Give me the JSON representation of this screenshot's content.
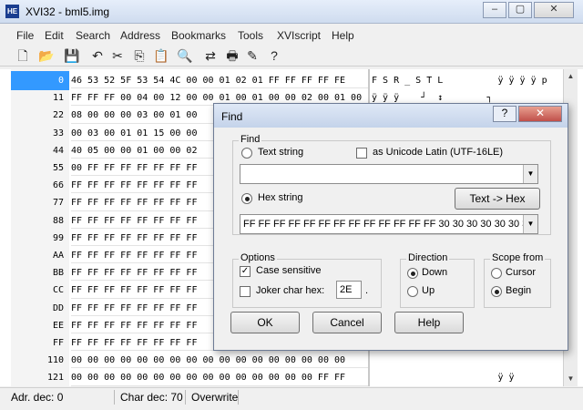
{
  "window": {
    "title": "XVI32 - bml5.img",
    "icon_label": "HE",
    "minimize": "–",
    "maximize": "▢",
    "close": "✕"
  },
  "menu": [
    "File",
    "Edit",
    "Search",
    "Address",
    "Bookmarks",
    "Tools",
    "XVIscript",
    "Help"
  ],
  "toolbar_icons": [
    "new-file-icon",
    "open-folder-icon",
    "save-icon",
    "cut-icon",
    "copy-icon",
    "paste-icon",
    "find-icon",
    "replace-icon",
    "print-icon",
    "edit-icon",
    "help-icon"
  ],
  "addresses": [
    "0",
    "11",
    "22",
    "33",
    "44",
    "55",
    "66",
    "77",
    "88",
    "99",
    "AA",
    "BB",
    "CC",
    "DD",
    "EE",
    "FF",
    "110",
    "121"
  ],
  "hex_rows": [
    "46 53 52 5F 53 54 4C 00 00 01 02 01 FF FF FF FF FE",
    "FF FF FF 00 04 00 12 00 00 01 00 01 00 00 02 00 01 00",
    "08 00 00 00 03 00 01 00",
    "00 03 00 01 01 15 00 00",
    "40 05 00 00 01 00 00 02",
    "00 FF FF FF FF FF FF FF",
    "FF FF FF FF FF FF FF FF",
    "FF FF FF FF FF FF FF FF",
    "FF FF FF FF FF FF FF FF",
    "FF FF FF FF FF FF FF FF",
    "FF FF FF FF FF FF FF FF",
    "FF FF FF FF FF FF FF FF",
    "FF FF FF FF FF FF FF FF",
    "FF FF FF FF FF FF FF FF",
    "FF FF FF FF FF FF FF FF",
    "FF FF FF FF FF FF FF FF",
    "00 00 00 00 00 00 00 00 00 00 00 00 00 00 00 00 00",
    "00 00 00 00 00 00 00 00 00 00 00 00 00 00 00 FF FF"
  ],
  "ascii_rows": [
    "F S R _ S T L          ÿ ÿ ÿ ÿ p",
    "ÿ ÿ ÿ    ┘  ↕        ┐",
    "",
    "",
    "",
    "",
    "",
    "",
    "",
    "",
    "",
    "",
    "",
    "",
    "",
    "",
    "",
    "                       ÿ ÿ"
  ],
  "status": {
    "addr": "Adr. dec: 0",
    "char": "Char dec: 70",
    "mode": "Overwrite"
  },
  "dialog": {
    "title": "Find",
    "help_btn": "?",
    "close_btn": "✕",
    "find_group": "Find",
    "text_string": "Text string",
    "unicode": "as Unicode Latin (UTF-16LE)",
    "text_value": "",
    "hex_string": "Hex string",
    "text_to_hex": "Text -> Hex",
    "hex_value": "FF FF FF FF FF FF FF FF FF FF FF FF FF 30 30 30 30 30 30 30 30",
    "options_group": "Options",
    "case_sensitive": "Case sensitive",
    "joker": "Joker char hex:",
    "joker_value": "2E",
    "joker_suffix": ".",
    "direction_group": "Direction",
    "down": "Down",
    "up": "Up",
    "scope_group": "Scope from",
    "cursor": "Cursor",
    "begin": "Begin",
    "ok": "OK",
    "cancel": "Cancel",
    "help": "Help"
  }
}
